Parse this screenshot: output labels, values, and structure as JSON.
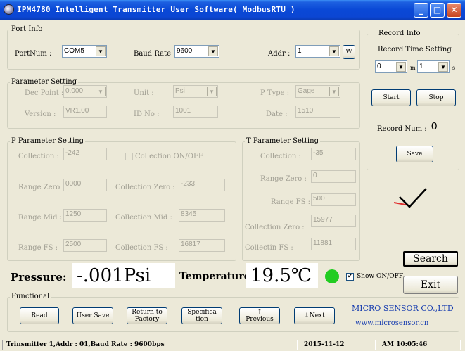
{
  "window": {
    "title": "IPM4780 Intelligent Transmitter User Software( ModbusRTU )",
    "minimize_glyph": "_",
    "maximize_glyph": "□",
    "close_glyph": "✕"
  },
  "port_info": {
    "group_label": "Port Info",
    "port_label": "PortNum :",
    "port_value": "COM5",
    "baud_label": "Baud Rate :",
    "baud_value": "9600",
    "addr_label": "Addr :",
    "addr_value": "1",
    "write_button": "W"
  },
  "record_info": {
    "group_label": "Record Info",
    "time_setting_label": "Record Time Setting",
    "minutes_value": "0",
    "minutes_unit": "m",
    "seconds_value": "1",
    "seconds_unit": "s",
    "start_button": "Start",
    "stop_button": "Stop",
    "record_num_label": "Record Num :",
    "record_num_value": "0",
    "save_button": "Save"
  },
  "parameter_setting": {
    "group_label": "Parameter Setting",
    "dec_point_label": "Dec Point :",
    "dec_point_value": "0.000",
    "unit_label": "Unit   :",
    "unit_value": "Psi",
    "p_type_label": "P Type :",
    "p_type_value": "Gage",
    "version_label": "Version :",
    "version_value": "VR1.00",
    "id_label": "ID No   :",
    "id_value": "1001",
    "date_label": "Date :",
    "date_value": "1510"
  },
  "p_parameter": {
    "group_label": "P Parameter Setting",
    "collection_label": "Collection :",
    "collection_value": "-242",
    "collection_onoff_label": "Collection ON/OFF",
    "range_zero_label": "Range Zero :",
    "range_zero_value": "0000",
    "collection_zero_label": "Collection Zero :",
    "collection_zero_value": "-233",
    "range_mid_label": "Range Mid :",
    "range_mid_value": "1250",
    "collection_mid_label": "Collection Mid :",
    "collection_mid_value": "8345",
    "range_fs_label": "Range FS  :",
    "range_fs_value": "2500",
    "collection_fs_label": "Collection FS  :",
    "collection_fs_value": "16817"
  },
  "t_parameter": {
    "group_label": "T Parameter Setting",
    "collection_label": "Collection :",
    "collection_value": "-35",
    "range_zero_label": "Range Zero :",
    "range_zero_value": "0",
    "range_fs_label": "Range FS :",
    "range_fs_value": "500",
    "collection_zero_label": "Collection Zero :",
    "collection_zero_value": "15977",
    "collection_fs_label": "Collectin FS   :",
    "collection_fs_value": "11881"
  },
  "readout": {
    "pressure_label": "Pressure:",
    "pressure_value": "-.001Psi",
    "temperature_label": "Temperature:",
    "temperature_value": "19.5℃",
    "indicator_color": "#22cc22",
    "show_onoff_label": "Show ON/OFF",
    "show_onoff_checked": "✔",
    "search_button": "Search",
    "exit_button": "Exit"
  },
  "functional": {
    "group_label": "Functional",
    "buttons": [
      "Read",
      "User Save",
      "Return to\nFactory",
      "Specifica\ntion",
      "↑\nPrevious",
      "↓Next"
    ],
    "company_name": "MICRO SENSOR CO.,LTD",
    "company_url": "www.microsensor.cn",
    "brand_color": "#1a3fb0"
  },
  "status_bar": {
    "connection": "Trinsmitter 1,Addr : 01,Baud Rate : 9600bps",
    "date": "2015-11-12",
    "time": "AM 10:05:46"
  }
}
